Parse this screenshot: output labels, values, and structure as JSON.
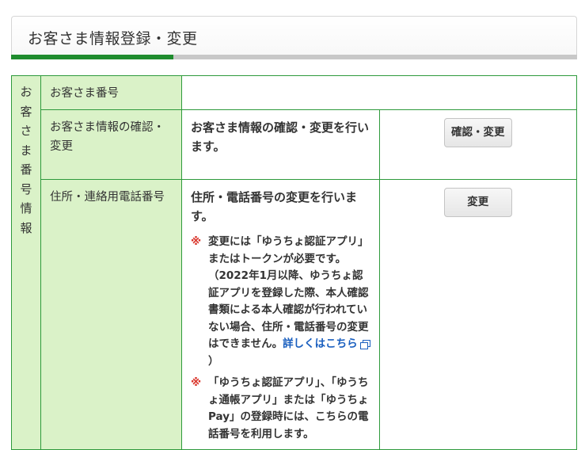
{
  "header": {
    "title": "お客さま情報登録・変更"
  },
  "group": {
    "label": "お客さま番号情報"
  },
  "rows": [
    {
      "label": "お客さま番号",
      "body": "",
      "action": ""
    },
    {
      "label": "お客さま情報の確認・変更",
      "body": "お客さま情報の確認・変更を行います。",
      "action": "確認・変更"
    },
    {
      "label": "住所・連絡用電話番号",
      "body": "住所・電話番号の変更を行います。",
      "action": "変更",
      "notes": [
        {
          "mark": "※",
          "text": "変更には「ゆうちょ認証アプリ」またはトークンが必要です。（2022年1月以降、ゆうちょ認証アプリを登録した際、本人確認書類による本人確認が行われていない場合、住所・電話番号の変更はできません。",
          "link": "詳しくはこちら",
          "after": "）"
        },
        {
          "mark": "※",
          "text": "「ゆうちょ認証アプリ」、「ゆうちょ通帳アプリ」または「ゆうちょPay」の登録時には、こちらの電話番号を利用します。"
        }
      ]
    }
  ],
  "colors": {
    "accent_green": "#1f8c2e",
    "header_cell_bg": "#daf2c8",
    "border_green": "#2e9a3c",
    "note_mark_red": "#d9342a",
    "link_blue": "#1a5fbf"
  },
  "icons": {
    "external_link": "external-link-icon"
  }
}
